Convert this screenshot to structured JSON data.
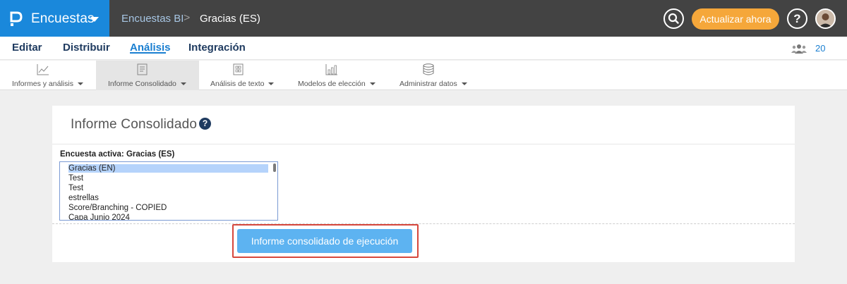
{
  "header": {
    "brand": "Encuestas",
    "breadcrumb_parent": "Encuestas BI",
    "breadcrumb_separator": ">",
    "breadcrumb_current": "Gracias (ES)",
    "update_button": "Actualizar ahora",
    "help_label": "?",
    "brand_color": "#1a88db",
    "bar_color": "#434343",
    "update_color": "#f5a73a"
  },
  "nav": {
    "items": [
      {
        "label": "Editar"
      },
      {
        "label": "Distribuir"
      },
      {
        "label": "Análisis",
        "active": true
      },
      {
        "label": "Integración"
      }
    ],
    "user_count": "20"
  },
  "subnav": {
    "items": [
      {
        "label": "Informes y análisis",
        "icon": "line-chart-icon"
      },
      {
        "label": "Informe Consolidado",
        "icon": "document-icon",
        "active": true
      },
      {
        "label": "Análisis de texto",
        "icon": "text-grid-icon"
      },
      {
        "label": "Modelos de elección",
        "icon": "bar-chart-icon"
      },
      {
        "label": "Administrar datos",
        "icon": "database-icon"
      }
    ]
  },
  "card": {
    "title": "Informe Consolidado",
    "help": "?",
    "active_survey_label": "Encuesta activa: Gracias (ES)",
    "survey_options": [
      "Gracias (EN)",
      "Test",
      "Test",
      "estrellas",
      "Score/Branching - COPIED",
      "Capa Junio 2024"
    ],
    "selected_option": "Gracias (EN)",
    "run_button": "Informe consolidado de ejecución"
  }
}
